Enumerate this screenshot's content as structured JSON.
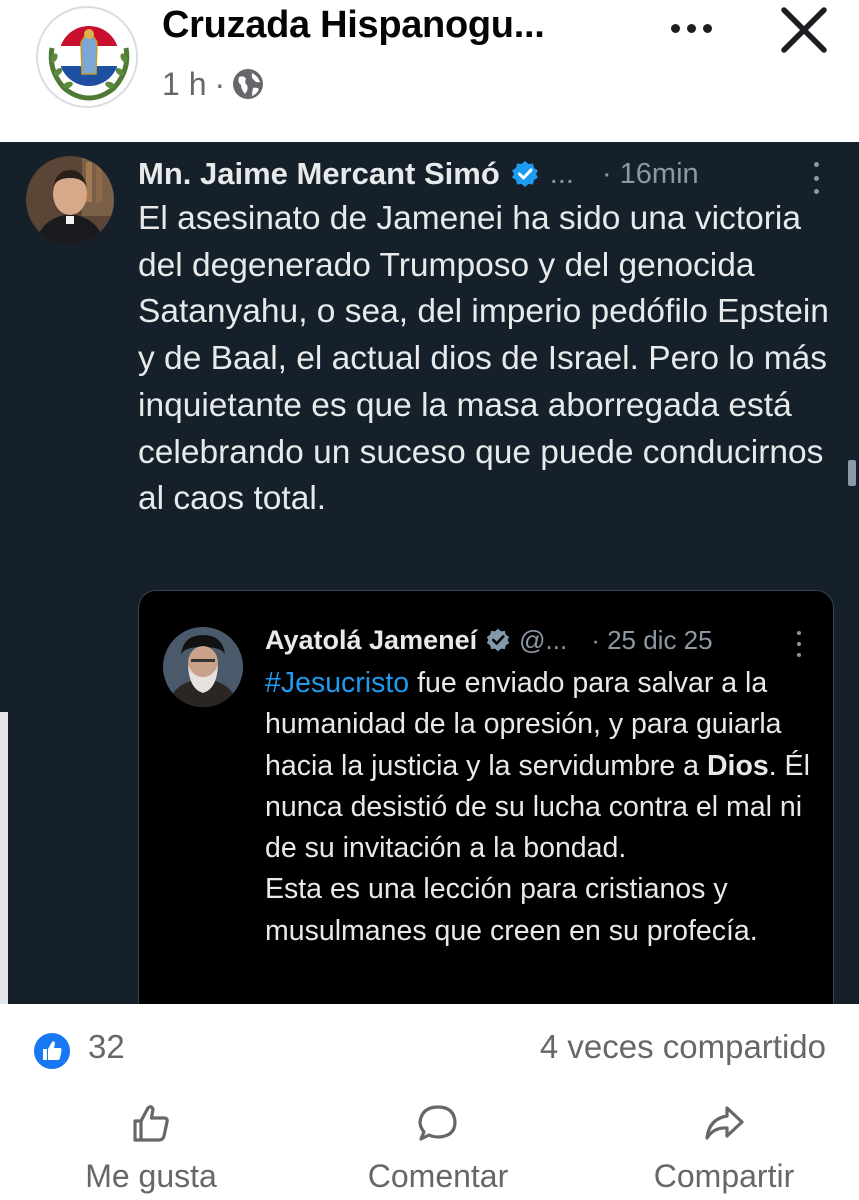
{
  "post": {
    "page_name": "Cruzada Hispanogu...",
    "time": "1 h",
    "separator": "·",
    "audience_icon": "globe-icon",
    "more_icon": "more-horizontal-icon",
    "close_icon": "close-icon"
  },
  "tweet": {
    "author": "Mn. Jaime Mercant Simó",
    "handle": "...",
    "time": "· 16min",
    "text": "El asesinato de Jamenei ha sido una victoria del degenerado Trumposo y del genocida Satanyahu, o sea, del imperio pedófilo Epstein y de Baal, el actual dios de Israel. Pero lo más inquietante es que la masa aborregada está celebrando un suceso que puede conducirnos al caos total.",
    "quoted": {
      "author": "Ayatolá Jameneí",
      "handle": "@...",
      "time": "· 25 dic 25",
      "hashtag": "#Jesucristo",
      "text_1": " fue enviado para salvar a la humanidad de la opresión, y para guiarla hacia la justicia y la servidumbre a ",
      "bold": "Dios",
      "text_2": ". Él nunca desistió de su lucha contra el mal ni de su invitación a la bondad.",
      "text_3": "Esta es una lección para cristianos y musulmanes que creen en su profecía."
    }
  },
  "stats": {
    "likes": "32",
    "shares": "4 veces compartido"
  },
  "actions": {
    "like": "Me gusta",
    "comment": "Comentar",
    "share": "Compartir"
  },
  "colors": {
    "facebook_blue": "#1877f2",
    "twitter_bg": "#15202b",
    "twitter_blue": "#1d9bf0",
    "muted": "#65676b"
  }
}
